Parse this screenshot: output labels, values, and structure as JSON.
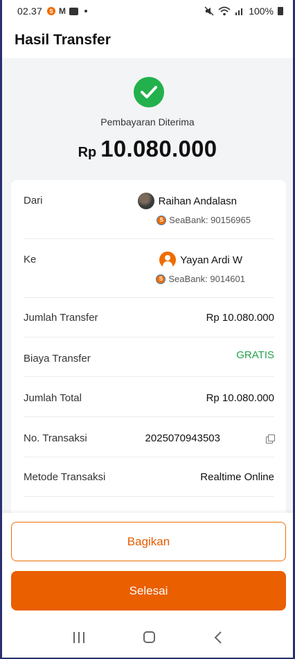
{
  "status_bar": {
    "time": "02.37",
    "battery": "100%",
    "icons": [
      "seabank-notification-icon",
      "gmail-icon",
      "news-icon",
      "dot-icon",
      "mute-icon",
      "wifi-icon",
      "signal-icon",
      "battery-icon"
    ]
  },
  "header": {
    "title": "Hasil Transfer"
  },
  "result": {
    "status": "Pembayaran Diterima",
    "currency": "Rp",
    "amount": "10.080.000"
  },
  "details": {
    "from": {
      "label": "Dari",
      "name": "Raihan Andalasn",
      "bank": "SeaBank: 90156965"
    },
    "to": {
      "label": "Ke",
      "name": "Yayan Ardi W",
      "bank": "SeaBank: 9014601"
    },
    "rows": [
      {
        "label": "Jumlah Transfer",
        "value": "Rp 10.080.000"
      },
      {
        "label": "Biaya Transfer",
        "value": "GRATIS"
      },
      {
        "label": "Jumlah Total",
        "value": "Rp 10.080.000"
      },
      {
        "label": "No. Transaksi",
        "value": "2025070943503"
      },
      {
        "label": "Metode Transaksi",
        "value": "Realtime Online"
      }
    ]
  },
  "actions": {
    "share": "Bagikan",
    "done": "Selesai"
  },
  "colors": {
    "accent": "#ea5f00",
    "success": "#22b14c",
    "free_text": "#22a34a"
  }
}
